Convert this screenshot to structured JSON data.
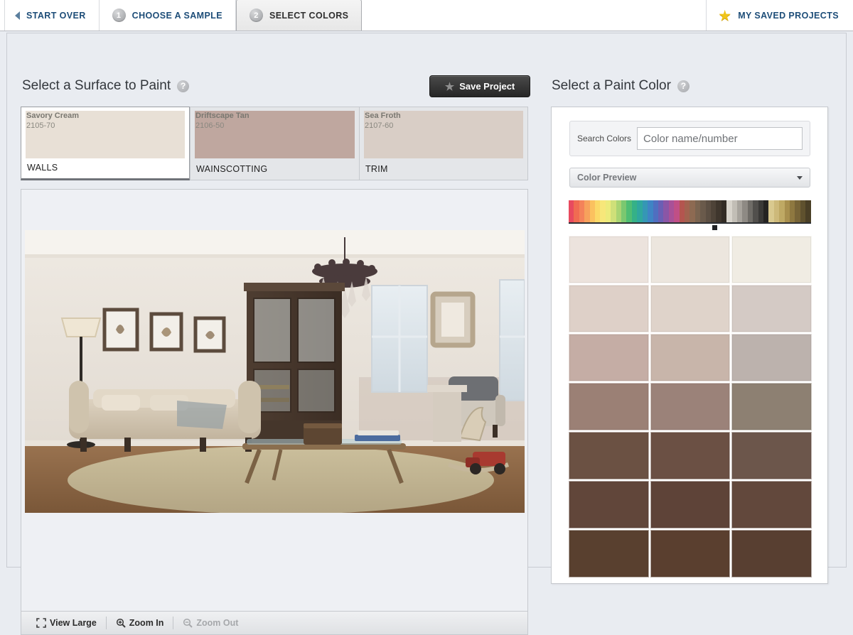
{
  "tabs": [
    {
      "id": "start-over",
      "label": "START OVER",
      "num": null,
      "active": false
    },
    {
      "id": "choose-a-sample",
      "label": "CHOOSE A SAMPLE",
      "num": "1",
      "active": false
    },
    {
      "id": "select-colors",
      "label": "SELECT COLORS",
      "num": "2",
      "active": true
    }
  ],
  "saved_projects": {
    "label": "MY SAVED PROJECTS",
    "icon": "star-icon"
  },
  "left": {
    "title": "Select a Surface to Paint",
    "help": "?",
    "save_button": {
      "label": "Save Project",
      "icon": "star-icon"
    },
    "surfaces": [
      {
        "label": "WALLS",
        "color_name": "Savory Cream",
        "color_number": "2105-70",
        "swatch": "#e8e0d6",
        "selected": true
      },
      {
        "label": "WAINSCOTTING",
        "color_name": "Driftscape Tan",
        "color_number": "2106-50",
        "swatch": "#bfa79f",
        "selected": false
      },
      {
        "label": "TRIM",
        "color_name": "Sea Froth",
        "color_number": "2107-60",
        "swatch": "#d9cec6",
        "selected": false
      }
    ],
    "toolbar": [
      {
        "id": "view-large",
        "label": "View Large",
        "icon": "expand-icon",
        "disabled": false
      },
      {
        "id": "zoom-in",
        "label": "Zoom In",
        "icon": "zoom-in-icon",
        "disabled": false
      },
      {
        "id": "zoom-out",
        "label": "Zoom Out",
        "icon": "zoom-out-icon",
        "disabled": true
      }
    ]
  },
  "right": {
    "title": "Select a Paint Color",
    "help": "?",
    "search": {
      "label": "Search Colors",
      "value": "",
      "placeholder": "Color name/number"
    },
    "collection_select": {
      "selected": "Color Preview",
      "icon": "chevron-down-icon"
    },
    "spectrum": {
      "marker_position_pct": 60,
      "bands": [
        "#e84a5f",
        "#f06b52",
        "#f4825a",
        "#f7a15c",
        "#fbc15f",
        "#fbd968",
        "#f7e77a",
        "#eceb7c",
        "#cfe079",
        "#a9d473",
        "#7bc870",
        "#4fbd73",
        "#35b187",
        "#2fa79e",
        "#3597b5",
        "#3f84c4",
        "#4f6fc0",
        "#6a5fb4",
        "#8a56a6",
        "#a85198",
        "#c04f86",
        "#b4554f",
        "#a2624f",
        "#8d6a52",
        "#7a6450",
        "#6a5a4b",
        "#5c4f43",
        "#4e4338",
        "#3f362d",
        "#332c25",
        "#d8d4cc",
        "#c2beb6",
        "#a8a49d",
        "#8e8a84",
        "#6f6c67",
        "#514f4c",
        "#3a3937",
        "#242322",
        "#d9c98f",
        "#cdb97a",
        "#bfa964",
        "#a88f4e",
        "#8e7840",
        "#776437",
        "#5f512e",
        "#4a3f26"
      ]
    },
    "grid_colors": [
      "#ece3dd",
      "#ece6de",
      "#f0ece3",
      "#ded0c8",
      "#dfd3ca",
      "#d4cac5",
      "#c5ada5",
      "#c8b5aa",
      "#bcb2ad",
      "#9b8075",
      "#9b8279",
      "#8d8072",
      "#6b5143",
      "#6b5044",
      "#6c564b",
      "#61463a",
      "#5e4338",
      "#62483c",
      "#59402f",
      "#5a3f2f",
      "#583f31"
    ]
  }
}
